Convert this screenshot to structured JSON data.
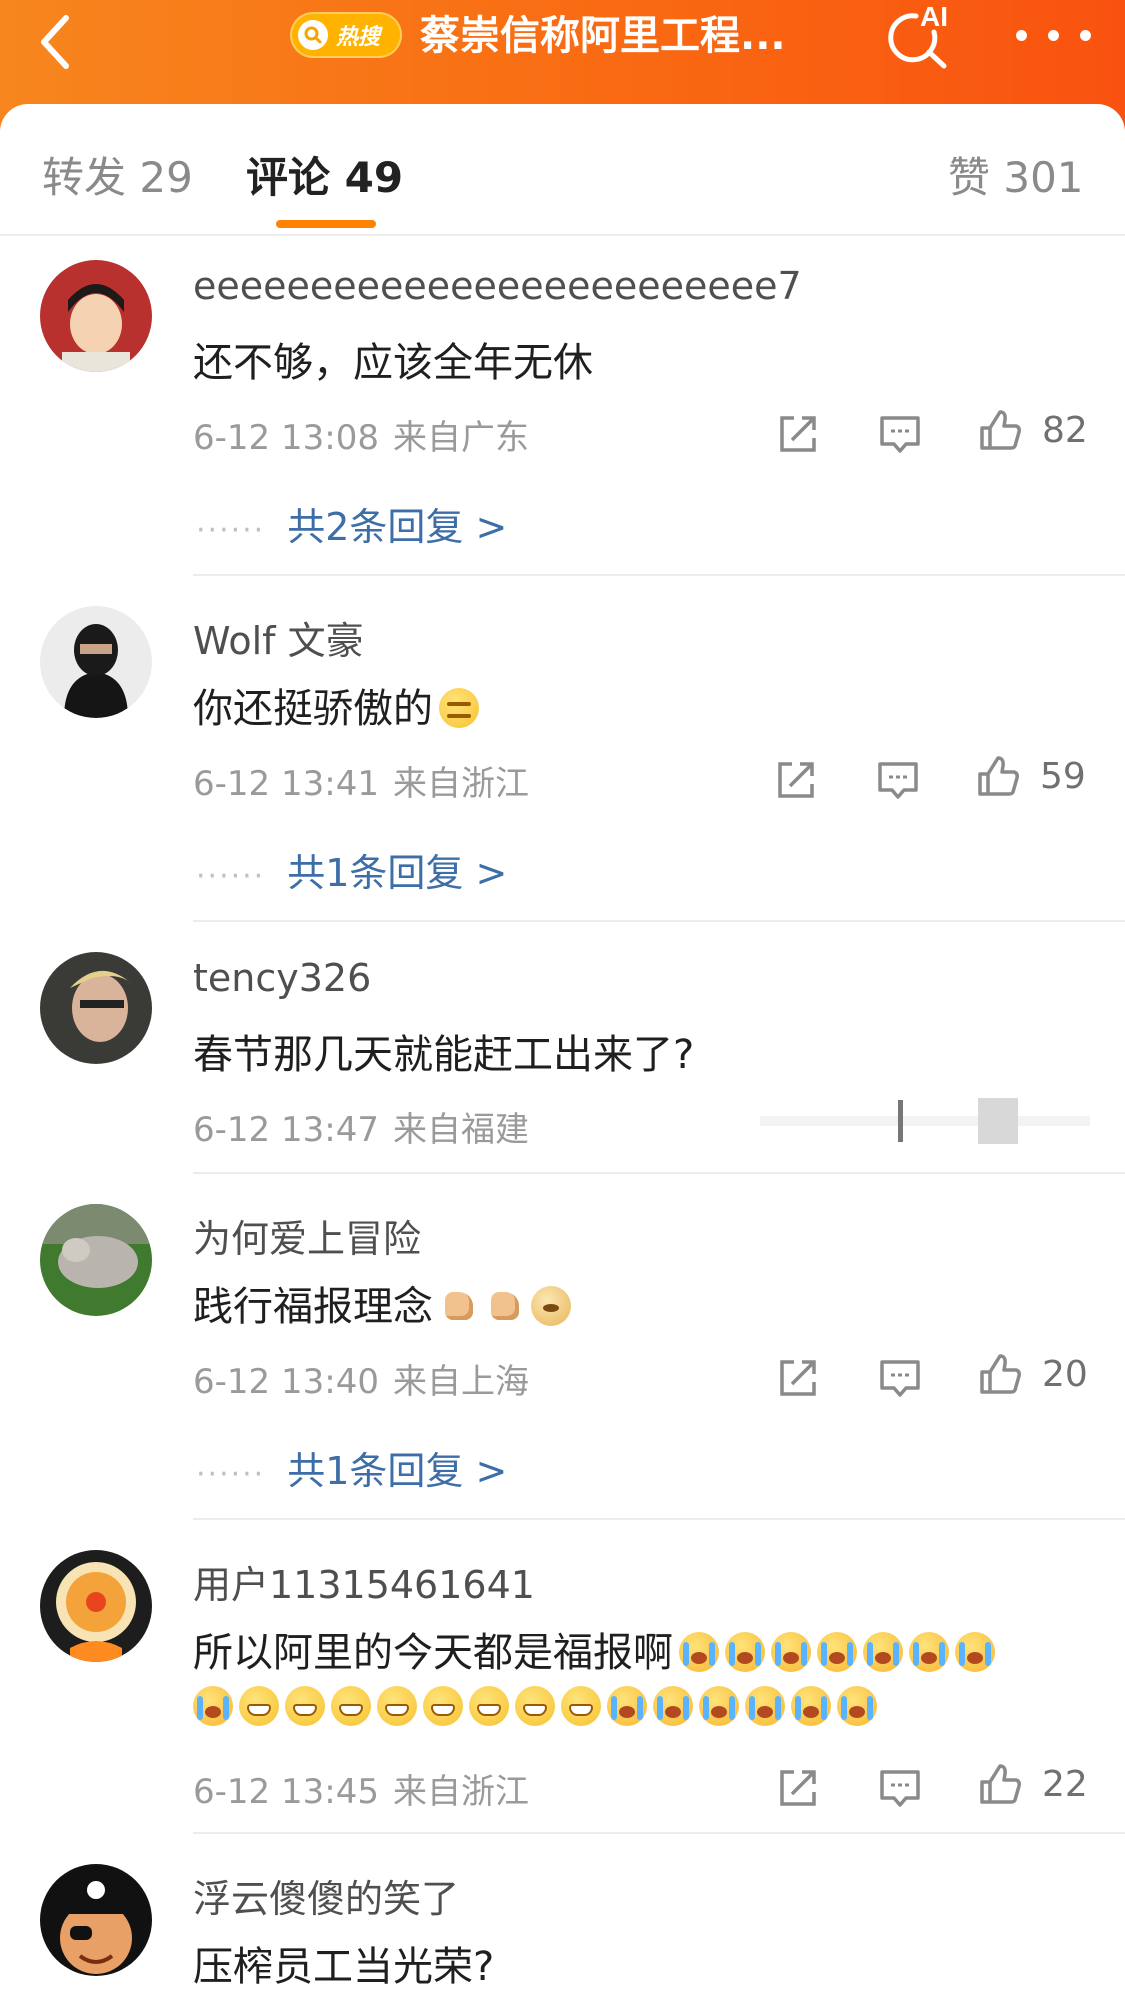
{
  "header": {
    "badge_label": "热搜",
    "title": "蔡崇信称阿里工程...",
    "ai_label": "AI"
  },
  "tabs": [
    {
      "label": "转发 29"
    },
    {
      "label": "评论 49"
    },
    {
      "label": "赞 301"
    }
  ],
  "comments": [
    {
      "user": "eeeeeeeeeeeeeeeeeeeeeeeee7",
      "text": "还不够，应该全年无休",
      "time": "6-12 13:08",
      "location": "来自广东",
      "likes": "82",
      "replies": "共2条回复 >"
    },
    {
      "user": "Wolf 文豪",
      "text": "你还挺骄傲的",
      "emojis": [
        "smirk"
      ],
      "time": "6-12 13:41",
      "location": "来自浙江",
      "likes": "59",
      "replies": "共1条回复 >"
    },
    {
      "user": "tency326",
      "text": "春节那几天就能赶工出来了?",
      "time": "6-12 13:47",
      "location": "来自福建"
    },
    {
      "user": "为何爱上冒险",
      "text": "践行福报理念",
      "emojis": [
        "thumbs-up",
        "thumbs-up",
        "doge"
      ],
      "time": "6-12 13:40",
      "location": "来自上海",
      "likes": "20",
      "replies": "共1条回复 >"
    },
    {
      "user": "用户11315461641",
      "text": "所以阿里的今天都是福报啊",
      "emojis_line1": [
        "cry",
        "cry",
        "cry",
        "cry",
        "cry",
        "cry",
        "cry"
      ],
      "emojis_line2": [
        "cry",
        "grin",
        "grin",
        "grin",
        "grin",
        "grin",
        "grin",
        "grin",
        "grin",
        "cry",
        "cry",
        "cry",
        "cry",
        "cry",
        "cry"
      ],
      "time": "6-12 13:45",
      "location": "来自浙江",
      "likes": "22"
    },
    {
      "user": "浮云傻傻的笑了",
      "text": "压榨员工当光荣?"
    }
  ],
  "colors": {
    "brand_orange": "#f96a12",
    "tab_underline": "#ff8200",
    "reply_link": "#3d6ea7"
  },
  "icons": [
    "back-arrow-icon",
    "search-icon",
    "ai-search-icon",
    "more-icon",
    "share-icon",
    "comment-icon",
    "like-icon"
  ]
}
